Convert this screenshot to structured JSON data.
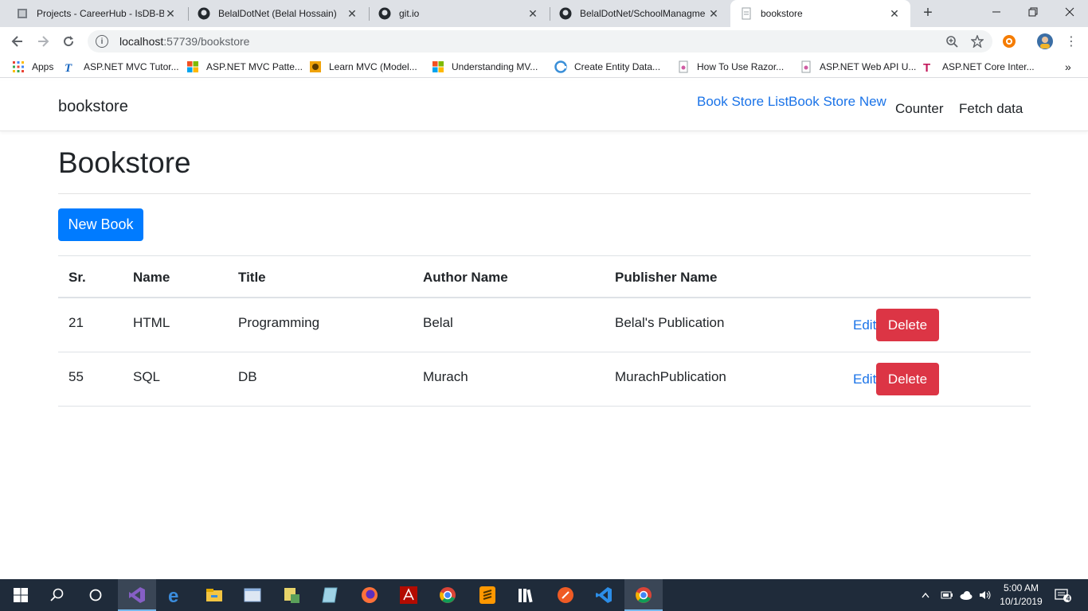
{
  "browser": {
    "tabs": [
      {
        "title": "Projects - CareerHub - IsDB-BI",
        "icon": "azure-devops-icon"
      },
      {
        "title": "BelalDotNet (Belal Hossain)",
        "icon": "github-icon"
      },
      {
        "title": "git.io",
        "icon": "github-icon"
      },
      {
        "title": "BelalDotNet/SchoolManagme",
        "icon": "github-icon"
      },
      {
        "title": "bookstore",
        "icon": "page-icon",
        "active": true
      }
    ],
    "url_host": "localhost",
    "url_path": ":57739/bookstore",
    "bookmarks": [
      {
        "label": "Apps",
        "icon": "apps-grid-icon"
      },
      {
        "label": "ASP.NET MVC Tutor...",
        "icon": "tutorialsteacher-icon"
      },
      {
        "label": "ASP.NET MVC Patte...",
        "icon": "microsoft-icon"
      },
      {
        "label": "Learn MVC (Model...",
        "icon": "codeproject-icon"
      },
      {
        "label": "Understanding MV...",
        "icon": "microsoft-icon"
      },
      {
        "label": "Create Entity Data...",
        "icon": "edge-icon"
      },
      {
        "label": "How To Use Razor...",
        "icon": "page-icon"
      },
      {
        "label": "ASP.NET Web API U...",
        "icon": "page-icon"
      },
      {
        "label": "ASP.NET Core Inter...",
        "icon": "tutorialsteacher-icon"
      }
    ]
  },
  "app": {
    "brand": "bookstore",
    "nav": {
      "book_store_list": "Book Store List",
      "book_store_new": "Book Store New",
      "counter": "Counter",
      "fetch_data": "Fetch data"
    },
    "title": "Bookstore",
    "new_book_label": "New Book",
    "table": {
      "headers": [
        "Sr.",
        "Name",
        "Title",
        "Author Name",
        "Publisher Name"
      ],
      "rows": [
        {
          "sr": "21",
          "name": "HTML",
          "title": "Programming",
          "author": "Belal",
          "publisher": "Belal's Publication"
        },
        {
          "sr": "55",
          "name": "SQL",
          "title": "DB",
          "author": "Murach",
          "publisher": "MurachPublication"
        }
      ],
      "edit_label": "Edit",
      "delete_label": "Delete"
    }
  },
  "taskbar": {
    "time": "5:00 AM",
    "date": "10/1/2019",
    "notification_count": "4"
  },
  "colors": {
    "primary": "#007bff",
    "danger": "#dc3545",
    "link": "#1a73e8"
  }
}
